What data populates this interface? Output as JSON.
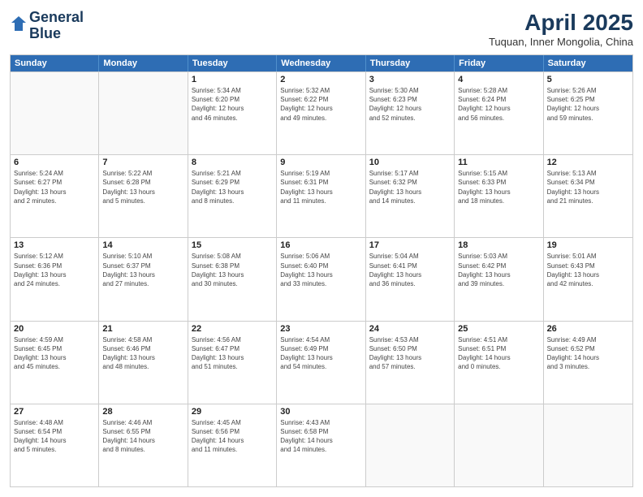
{
  "logo": {
    "line1": "General",
    "line2": "Blue"
  },
  "title": "April 2025",
  "subtitle": "Tuquan, Inner Mongolia, China",
  "weekdays": [
    "Sunday",
    "Monday",
    "Tuesday",
    "Wednesday",
    "Thursday",
    "Friday",
    "Saturday"
  ],
  "rows": [
    [
      {
        "day": "",
        "info": ""
      },
      {
        "day": "",
        "info": ""
      },
      {
        "day": "1",
        "info": "Sunrise: 5:34 AM\nSunset: 6:20 PM\nDaylight: 12 hours\nand 46 minutes."
      },
      {
        "day": "2",
        "info": "Sunrise: 5:32 AM\nSunset: 6:22 PM\nDaylight: 12 hours\nand 49 minutes."
      },
      {
        "day": "3",
        "info": "Sunrise: 5:30 AM\nSunset: 6:23 PM\nDaylight: 12 hours\nand 52 minutes."
      },
      {
        "day": "4",
        "info": "Sunrise: 5:28 AM\nSunset: 6:24 PM\nDaylight: 12 hours\nand 56 minutes."
      },
      {
        "day": "5",
        "info": "Sunrise: 5:26 AM\nSunset: 6:25 PM\nDaylight: 12 hours\nand 59 minutes."
      }
    ],
    [
      {
        "day": "6",
        "info": "Sunrise: 5:24 AM\nSunset: 6:27 PM\nDaylight: 13 hours\nand 2 minutes."
      },
      {
        "day": "7",
        "info": "Sunrise: 5:22 AM\nSunset: 6:28 PM\nDaylight: 13 hours\nand 5 minutes."
      },
      {
        "day": "8",
        "info": "Sunrise: 5:21 AM\nSunset: 6:29 PM\nDaylight: 13 hours\nand 8 minutes."
      },
      {
        "day": "9",
        "info": "Sunrise: 5:19 AM\nSunset: 6:31 PM\nDaylight: 13 hours\nand 11 minutes."
      },
      {
        "day": "10",
        "info": "Sunrise: 5:17 AM\nSunset: 6:32 PM\nDaylight: 13 hours\nand 14 minutes."
      },
      {
        "day": "11",
        "info": "Sunrise: 5:15 AM\nSunset: 6:33 PM\nDaylight: 13 hours\nand 18 minutes."
      },
      {
        "day": "12",
        "info": "Sunrise: 5:13 AM\nSunset: 6:34 PM\nDaylight: 13 hours\nand 21 minutes."
      }
    ],
    [
      {
        "day": "13",
        "info": "Sunrise: 5:12 AM\nSunset: 6:36 PM\nDaylight: 13 hours\nand 24 minutes."
      },
      {
        "day": "14",
        "info": "Sunrise: 5:10 AM\nSunset: 6:37 PM\nDaylight: 13 hours\nand 27 minutes."
      },
      {
        "day": "15",
        "info": "Sunrise: 5:08 AM\nSunset: 6:38 PM\nDaylight: 13 hours\nand 30 minutes."
      },
      {
        "day": "16",
        "info": "Sunrise: 5:06 AM\nSunset: 6:40 PM\nDaylight: 13 hours\nand 33 minutes."
      },
      {
        "day": "17",
        "info": "Sunrise: 5:04 AM\nSunset: 6:41 PM\nDaylight: 13 hours\nand 36 minutes."
      },
      {
        "day": "18",
        "info": "Sunrise: 5:03 AM\nSunset: 6:42 PM\nDaylight: 13 hours\nand 39 minutes."
      },
      {
        "day": "19",
        "info": "Sunrise: 5:01 AM\nSunset: 6:43 PM\nDaylight: 13 hours\nand 42 minutes."
      }
    ],
    [
      {
        "day": "20",
        "info": "Sunrise: 4:59 AM\nSunset: 6:45 PM\nDaylight: 13 hours\nand 45 minutes."
      },
      {
        "day": "21",
        "info": "Sunrise: 4:58 AM\nSunset: 6:46 PM\nDaylight: 13 hours\nand 48 minutes."
      },
      {
        "day": "22",
        "info": "Sunrise: 4:56 AM\nSunset: 6:47 PM\nDaylight: 13 hours\nand 51 minutes."
      },
      {
        "day": "23",
        "info": "Sunrise: 4:54 AM\nSunset: 6:49 PM\nDaylight: 13 hours\nand 54 minutes."
      },
      {
        "day": "24",
        "info": "Sunrise: 4:53 AM\nSunset: 6:50 PM\nDaylight: 13 hours\nand 57 minutes."
      },
      {
        "day": "25",
        "info": "Sunrise: 4:51 AM\nSunset: 6:51 PM\nDaylight: 14 hours\nand 0 minutes."
      },
      {
        "day": "26",
        "info": "Sunrise: 4:49 AM\nSunset: 6:52 PM\nDaylight: 14 hours\nand 3 minutes."
      }
    ],
    [
      {
        "day": "27",
        "info": "Sunrise: 4:48 AM\nSunset: 6:54 PM\nDaylight: 14 hours\nand 5 minutes."
      },
      {
        "day": "28",
        "info": "Sunrise: 4:46 AM\nSunset: 6:55 PM\nDaylight: 14 hours\nand 8 minutes."
      },
      {
        "day": "29",
        "info": "Sunrise: 4:45 AM\nSunset: 6:56 PM\nDaylight: 14 hours\nand 11 minutes."
      },
      {
        "day": "30",
        "info": "Sunrise: 4:43 AM\nSunset: 6:58 PM\nDaylight: 14 hours\nand 14 minutes."
      },
      {
        "day": "",
        "info": ""
      },
      {
        "day": "",
        "info": ""
      },
      {
        "day": "",
        "info": ""
      }
    ]
  ]
}
